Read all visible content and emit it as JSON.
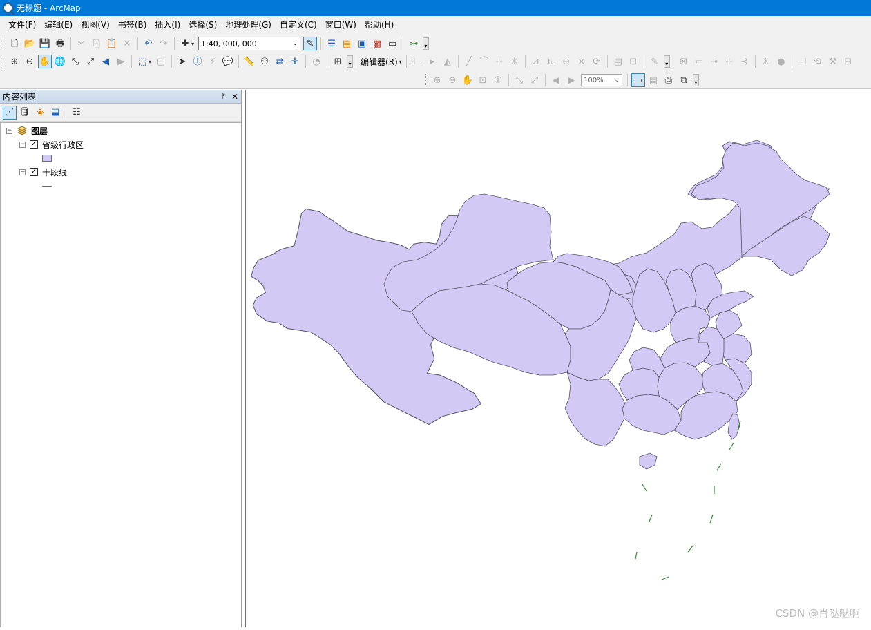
{
  "window": {
    "title": "无标题 - ArcMap"
  },
  "menubar": {
    "items": [
      "文件(F)",
      "编辑(E)",
      "视图(V)",
      "书签(B)",
      "插入(I)",
      "选择(S)",
      "地理处理(G)",
      "自定义(C)",
      "窗口(W)",
      "帮助(H)"
    ]
  },
  "toolbar": {
    "scale_value": "1:40, 000, 000",
    "editor_label": "编辑器(R)",
    "zoom_value": "100%"
  },
  "toc": {
    "title": "内容列表",
    "pin_glyph": "📌",
    "close_glyph": "✕",
    "root_label": "图层",
    "layers": [
      {
        "label": "省级行政区",
        "checked": true,
        "symbol": "polygon",
        "color": "#d3c9f5"
      },
      {
        "label": "十段线",
        "checked": true,
        "symbol": "line",
        "color": "#2f8f2f"
      }
    ],
    "expander_glyph": "⊟",
    "check_glyph": "✓"
  },
  "map": {
    "fill_color": "#d3c9f5",
    "stroke_color": "#555566",
    "line_color": "#2f8f2f"
  },
  "watermark": "CSDN @肖哒哒啊"
}
